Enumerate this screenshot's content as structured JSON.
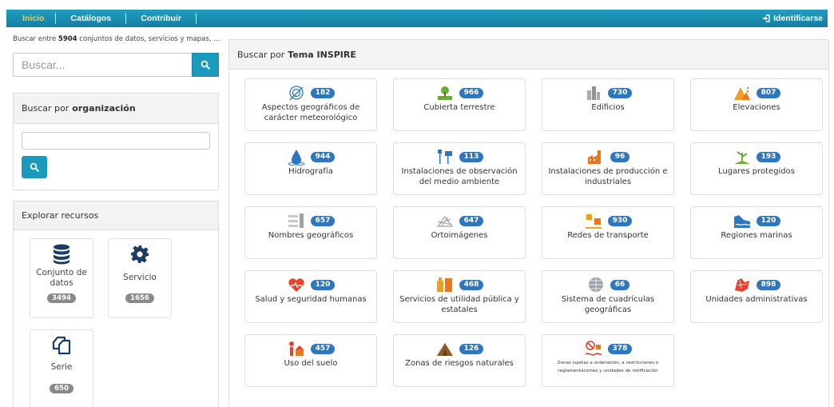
{
  "navbar": {
    "items": [
      {
        "label": "Inicio",
        "active": true
      },
      {
        "label": "Catálogos",
        "active": false
      },
      {
        "label": "Contribuir",
        "active": false
      }
    ],
    "login_label": "Identificarse",
    "login_icon": "sign-in-icon",
    "active_color": "#f7c64a",
    "bg_color": "#1a8fb3"
  },
  "search": {
    "count_prefix": "Buscar entre ",
    "count_value": "5904",
    "count_suffix": " conjuntos de datos, servicios y mapas, ...",
    "placeholder": "Buscar...",
    "button_icon": "search-icon"
  },
  "org_search": {
    "title_prefix": "Buscar por",
    "title_bold": "organización",
    "input_value": "",
    "button_icon": "search-icon"
  },
  "resources": {
    "title": "Explorar recursos",
    "items": [
      {
        "label": "Conjunto de datos",
        "count": "3494",
        "icon": "database-icon"
      },
      {
        "label": "Servicio",
        "count": "1656",
        "icon": "gear-icon"
      },
      {
        "label": "Serie",
        "count": "650",
        "icon": "copy-icon"
      }
    ]
  },
  "inspire": {
    "title_prefix": "Buscar por",
    "title_bold": "Tema INSPIRE",
    "badge_color": "#2f77bd",
    "themes": [
      {
        "label": "Aspectos geográficos de carácter meteorológico",
        "count": "182",
        "icon": "meteorological-icon"
      },
      {
        "label": "Cubierta terrestre",
        "count": "966",
        "icon": "land-cover-icon"
      },
      {
        "label": "Edificios",
        "count": "730",
        "icon": "buildings-icon"
      },
      {
        "label": "Elevaciones",
        "count": "807",
        "icon": "elevation-icon"
      },
      {
        "label": "Hidrografía",
        "count": "944",
        "icon": "hydrography-icon"
      },
      {
        "label": "Instalaciones de observación del medio ambiente",
        "count": "113",
        "icon": "monitoring-facility-icon"
      },
      {
        "label": "Instalaciones de producción e industriales",
        "count": "96",
        "icon": "industrial-facility-icon"
      },
      {
        "label": "Lugares protegidos",
        "count": "193",
        "icon": "protected-sites-icon"
      },
      {
        "label": "Nombres geográficos",
        "count": "657",
        "icon": "geographical-names-icon"
      },
      {
        "label": "Ortoimágenes",
        "count": "647",
        "icon": "orthoimagery-icon"
      },
      {
        "label": "Redes de transporte",
        "count": "930",
        "icon": "transport-networks-icon"
      },
      {
        "label": "Regiones marinas",
        "count": "120",
        "icon": "sea-regions-icon"
      },
      {
        "label": "Salud y seguridad humanas",
        "count": "120",
        "icon": "human-health-icon"
      },
      {
        "label": "Servicios de utilidad pública y estatales",
        "count": "468",
        "icon": "utility-services-icon"
      },
      {
        "label": "Sistema de cuadrículas geográficas",
        "count": "66",
        "icon": "grid-systems-icon"
      },
      {
        "label": "Unidades administrativas",
        "count": "898",
        "icon": "administrative-units-icon"
      },
      {
        "label": "Uso del suelo",
        "count": "457",
        "icon": "land-use-icon"
      },
      {
        "label": "Zonas de riesgos naturales",
        "count": "126",
        "icon": "natural-risk-zones-icon"
      },
      {
        "label": "Zonas sujetas a ordenación, a restricciones o reglamentaciones y unidades de notificación",
        "count": "378",
        "icon": "management-zones-icon"
      }
    ]
  }
}
